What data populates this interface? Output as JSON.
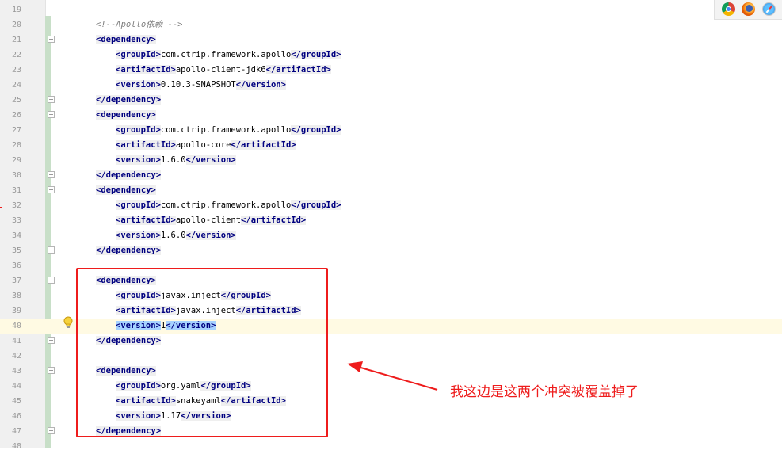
{
  "editor": {
    "first_line": 19,
    "current_line": 40,
    "fold_lines": [
      21,
      25,
      26,
      30,
      31,
      35,
      37,
      41,
      43,
      47
    ],
    "lines": [
      {
        "n": "19",
        "indent": 0,
        "tokens": []
      },
      {
        "n": "20",
        "indent": 1,
        "tokens": [
          {
            "t": "comment",
            "v": "<!--Apollo依赖 -->"
          }
        ]
      },
      {
        "n": "21",
        "indent": 1,
        "tokens": [
          {
            "t": "tag",
            "v": "<dependency>"
          }
        ]
      },
      {
        "n": "22",
        "indent": 2,
        "tokens": [
          {
            "t": "tag",
            "v": "<groupId>"
          },
          {
            "t": "txt",
            "v": "com.ctrip.framework.apollo"
          },
          {
            "t": "tag",
            "v": "</groupId>"
          }
        ]
      },
      {
        "n": "23",
        "indent": 2,
        "tokens": [
          {
            "t": "tag",
            "v": "<artifactId>"
          },
          {
            "t": "txt",
            "v": "apollo-client-jdk6"
          },
          {
            "t": "tag",
            "v": "</artifactId>"
          }
        ]
      },
      {
        "n": "24",
        "indent": 2,
        "tokens": [
          {
            "t": "tag",
            "v": "<version>"
          },
          {
            "t": "txt",
            "v": "0.10.3-SNAPSHOT"
          },
          {
            "t": "tag",
            "v": "</version>"
          }
        ]
      },
      {
        "n": "25",
        "indent": 1,
        "tokens": [
          {
            "t": "tag",
            "v": "</dependency>"
          }
        ]
      },
      {
        "n": "26",
        "indent": 1,
        "tokens": [
          {
            "t": "tag",
            "v": "<dependency>"
          }
        ]
      },
      {
        "n": "27",
        "indent": 2,
        "tokens": [
          {
            "t": "tag",
            "v": "<groupId>"
          },
          {
            "t": "txt",
            "v": "com.ctrip.framework.apollo"
          },
          {
            "t": "tag",
            "v": "</groupId>"
          }
        ]
      },
      {
        "n": "28",
        "indent": 2,
        "tokens": [
          {
            "t": "tag",
            "v": "<artifactId>"
          },
          {
            "t": "txt",
            "v": "apollo-core"
          },
          {
            "t": "tag",
            "v": "</artifactId>"
          }
        ]
      },
      {
        "n": "29",
        "indent": 2,
        "tokens": [
          {
            "t": "tag",
            "v": "<version>"
          },
          {
            "t": "txt",
            "v": "1.6.0"
          },
          {
            "t": "tag",
            "v": "</version>"
          }
        ]
      },
      {
        "n": "30",
        "indent": 1,
        "tokens": [
          {
            "t": "tag",
            "v": "</dependency>"
          }
        ]
      },
      {
        "n": "31",
        "indent": 1,
        "tokens": [
          {
            "t": "tag",
            "v": "<dependency>"
          }
        ]
      },
      {
        "n": "32",
        "indent": 2,
        "tokens": [
          {
            "t": "tag",
            "v": "<groupId>"
          },
          {
            "t": "txt",
            "v": "com.ctrip.framework.apollo"
          },
          {
            "t": "tag",
            "v": "</groupId>"
          }
        ]
      },
      {
        "n": "33",
        "indent": 2,
        "tokens": [
          {
            "t": "tag",
            "v": "<artifactId>"
          },
          {
            "t": "txt",
            "v": "apollo-client"
          },
          {
            "t": "tag",
            "v": "</artifactId>"
          }
        ]
      },
      {
        "n": "34",
        "indent": 2,
        "tokens": [
          {
            "t": "tag",
            "v": "<version>"
          },
          {
            "t": "txt",
            "v": "1.6.0"
          },
          {
            "t": "tag",
            "v": "</version>"
          }
        ]
      },
      {
        "n": "35",
        "indent": 1,
        "tokens": [
          {
            "t": "tag",
            "v": "</dependency>"
          }
        ]
      },
      {
        "n": "36",
        "indent": 0,
        "tokens": []
      },
      {
        "n": "37",
        "indent": 1,
        "tokens": [
          {
            "t": "tag",
            "v": "<dependency>"
          }
        ]
      },
      {
        "n": "38",
        "indent": 2,
        "tokens": [
          {
            "t": "tag",
            "v": "<groupId>"
          },
          {
            "t": "txt",
            "v": "javax.inject"
          },
          {
            "t": "tag",
            "v": "</groupId>"
          }
        ]
      },
      {
        "n": "39",
        "indent": 2,
        "tokens": [
          {
            "t": "tag",
            "v": "<artifactId>"
          },
          {
            "t": "txt",
            "v": "javax.inject"
          },
          {
            "t": "tag",
            "v": "</artifactId>"
          }
        ]
      },
      {
        "n": "40",
        "indent": 2,
        "tokens": [
          {
            "t": "tagsel",
            "v": "<version>"
          },
          {
            "t": "txt",
            "v": "1"
          },
          {
            "t": "tagsel",
            "v": "</version>"
          },
          {
            "t": "caret",
            "v": ""
          }
        ]
      },
      {
        "n": "41",
        "indent": 1,
        "tokens": [
          {
            "t": "tag",
            "v": "</dependency>"
          }
        ]
      },
      {
        "n": "42",
        "indent": 0,
        "tokens": []
      },
      {
        "n": "43",
        "indent": 1,
        "tokens": [
          {
            "t": "tag",
            "v": "<dependency>"
          }
        ]
      },
      {
        "n": "44",
        "indent": 2,
        "tokens": [
          {
            "t": "tag",
            "v": "<groupId>"
          },
          {
            "t": "txt",
            "v": "org.yaml"
          },
          {
            "t": "tag",
            "v": "</groupId>"
          }
        ]
      },
      {
        "n": "45",
        "indent": 2,
        "tokens": [
          {
            "t": "tag",
            "v": "<artifactId>"
          },
          {
            "t": "txt",
            "v": "snakeyaml"
          },
          {
            "t": "tag",
            "v": "</artifactId>"
          }
        ]
      },
      {
        "n": "46",
        "indent": 2,
        "tokens": [
          {
            "t": "tag",
            "v": "<version>"
          },
          {
            "t": "txt",
            "v": "1.17"
          },
          {
            "t": "tag",
            "v": "</version>"
          }
        ]
      },
      {
        "n": "47",
        "indent": 1,
        "tokens": [
          {
            "t": "tag",
            "v": "</dependency>"
          }
        ]
      },
      {
        "n": "48",
        "indent": 0,
        "tokens": []
      }
    ]
  },
  "browser_icons": [
    "chrome-icon",
    "firefox-icon",
    "safari-icon"
  ],
  "annotation": {
    "text": "我这边是这两个冲突被覆盖掉了",
    "color": "#ee1c1c"
  },
  "colors": {
    "tag": "#000080",
    "tag_bg": "#efefef",
    "selection": "#a6d2ff",
    "current_line": "#fffae3",
    "comment": "#808080",
    "change_bar": "#c8dfc8"
  }
}
